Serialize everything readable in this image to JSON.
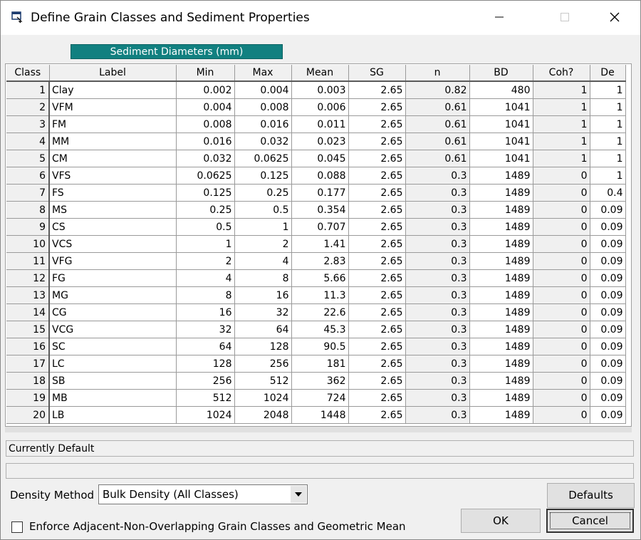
{
  "window": {
    "title": "Define Grain Classes and Sediment Properties"
  },
  "header_label": "Sediment Diameters (mm)",
  "grid": {
    "columns": [
      "Class",
      "Label",
      "Min",
      "Max",
      "Mean",
      "SG",
      "n",
      "BD",
      "Coh?",
      "De"
    ],
    "rows": [
      [
        "1",
        "Clay",
        "0.002",
        "0.004",
        "0.003",
        "2.65",
        "0.82",
        "480",
        "1",
        "1"
      ],
      [
        "2",
        "VFM",
        "0.004",
        "0.008",
        "0.006",
        "2.65",
        "0.61",
        "1041",
        "1",
        "1"
      ],
      [
        "3",
        "FM",
        "0.008",
        "0.016",
        "0.011",
        "2.65",
        "0.61",
        "1041",
        "1",
        "1"
      ],
      [
        "4",
        "MM",
        "0.016",
        "0.032",
        "0.023",
        "2.65",
        "0.61",
        "1041",
        "1",
        "1"
      ],
      [
        "5",
        "CM",
        "0.032",
        "0.0625",
        "0.045",
        "2.65",
        "0.61",
        "1041",
        "1",
        "1"
      ],
      [
        "6",
        "VFS",
        "0.0625",
        "0.125",
        "0.088",
        "2.65",
        "0.3",
        "1489",
        "0",
        "1"
      ],
      [
        "7",
        "FS",
        "0.125",
        "0.25",
        "0.177",
        "2.65",
        "0.3",
        "1489",
        "0",
        "0.4"
      ],
      [
        "8",
        "MS",
        "0.25",
        "0.5",
        "0.354",
        "2.65",
        "0.3",
        "1489",
        "0",
        "0.09"
      ],
      [
        "9",
        "CS",
        "0.5",
        "1",
        "0.707",
        "2.65",
        "0.3",
        "1489",
        "0",
        "0.09"
      ],
      [
        "10",
        "VCS",
        "1",
        "2",
        "1.41",
        "2.65",
        "0.3",
        "1489",
        "0",
        "0.09"
      ],
      [
        "11",
        "VFG",
        "2",
        "4",
        "2.83",
        "2.65",
        "0.3",
        "1489",
        "0",
        "0.09"
      ],
      [
        "12",
        "FG",
        "4",
        "8",
        "5.66",
        "2.65",
        "0.3",
        "1489",
        "0",
        "0.09"
      ],
      [
        "13",
        "MG",
        "8",
        "16",
        "11.3",
        "2.65",
        "0.3",
        "1489",
        "0",
        "0.09"
      ],
      [
        "14",
        "CG",
        "16",
        "32",
        "22.6",
        "2.65",
        "0.3",
        "1489",
        "0",
        "0.09"
      ],
      [
        "15",
        "VCG",
        "32",
        "64",
        "45.3",
        "2.65",
        "0.3",
        "1489",
        "0",
        "0.09"
      ],
      [
        "16",
        "SC",
        "64",
        "128",
        "90.5",
        "2.65",
        "0.3",
        "1489",
        "0",
        "0.09"
      ],
      [
        "17",
        "LC",
        "128",
        "256",
        "181",
        "2.65",
        "0.3",
        "1489",
        "0",
        "0.09"
      ],
      [
        "18",
        "SB",
        "256",
        "512",
        "362",
        "2.65",
        "0.3",
        "1489",
        "0",
        "0.09"
      ],
      [
        "19",
        "MB",
        "512",
        "1024",
        "724",
        "2.65",
        "0.3",
        "1489",
        "0",
        "0.09"
      ],
      [
        "20",
        "LB",
        "1024",
        "2048",
        "1448",
        "2.65",
        "0.3",
        "1489",
        "0",
        "0.09"
      ]
    ]
  },
  "status": {
    "line1": "Currently Default",
    "line2": ""
  },
  "density_method": {
    "label": "Density Method",
    "value": "Bulk Density (All Classes)"
  },
  "buttons": {
    "defaults": "Defaults",
    "ok": "OK",
    "cancel": "Cancel"
  },
  "enforce_checkbox": {
    "label": "Enforce Adjacent-Non-Overlapping Grain Classes and Geometric Mean",
    "checked": false
  }
}
